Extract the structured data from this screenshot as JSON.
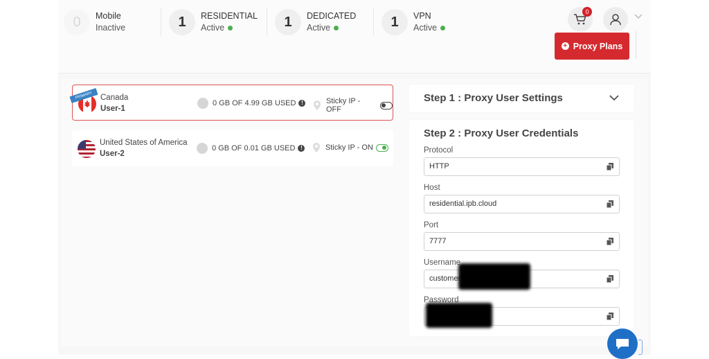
{
  "stats": [
    {
      "count": "0",
      "name": "Mobile",
      "status": "Inactive",
      "active": false
    },
    {
      "count": "1",
      "name": "RESIDENTIAL",
      "status": "Active",
      "active": true
    },
    {
      "count": "1",
      "name": "DEDICATED",
      "status": "Active",
      "active": true
    },
    {
      "count": "1",
      "name": "VPN",
      "status": "Active",
      "active": true
    }
  ],
  "header": {
    "cart_badge": "0",
    "cart_icon": "cart-icon",
    "user_icon": "user-icon",
    "plans_button": "Proxy Plans"
  },
  "proxies": [
    {
      "country": "Canada",
      "user": "User-1",
      "ribbon": "PRIMARY",
      "usage": "0 GB OF 4.99 GB USED",
      "sticky": "Sticky IP - OFF",
      "sticky_on": false
    },
    {
      "country": "United States of America",
      "user": "User-2",
      "ribbon": "",
      "usage": "0 GB OF 0.01 GB USED",
      "sticky": "Sticky IP - ON",
      "sticky_on": true
    }
  ],
  "step1": {
    "title": "Step 1 : Proxy User Settings"
  },
  "step2": {
    "title": "Step 2 : Proxy User Credentials",
    "fields": [
      {
        "label": "Protocol",
        "value": "HTTP"
      },
      {
        "label": "Host",
        "value": "residential.ipb.cloud"
      },
      {
        "label": "Port",
        "value": "7777"
      },
      {
        "label": "Username",
        "value": "customer"
      },
      {
        "label": "Password",
        "value": ""
      }
    ]
  },
  "colors": {
    "accent": "#d42a2f",
    "active": "#4caf50",
    "chat": "#1f6fc7"
  }
}
